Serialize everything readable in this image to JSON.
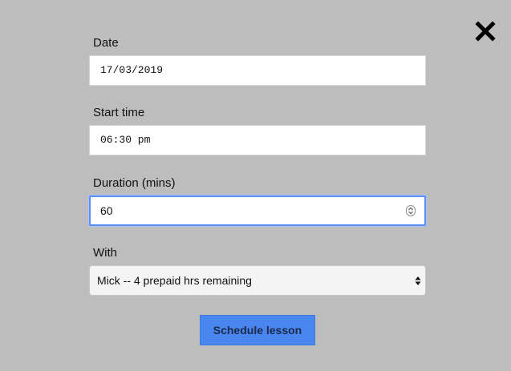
{
  "form": {
    "date": {
      "label": "Date",
      "value": "17/03/2019"
    },
    "start_time": {
      "label": "Start time",
      "value": "06:30 pm"
    },
    "duration": {
      "label": "Duration (mins)",
      "value": "60"
    },
    "with": {
      "label": "With",
      "selected": "Mick -- 4 prepaid hrs remaining"
    },
    "submit_label": "Schedule lesson"
  },
  "icons": {
    "close": "close-icon",
    "spinner": "number-spinner-icon",
    "select_arrows": "select-arrows-icon"
  },
  "colors": {
    "overlay_bg": "#bdbdbd",
    "focus_ring": "#5a8ef5",
    "button_bg": "#4a86f0"
  }
}
